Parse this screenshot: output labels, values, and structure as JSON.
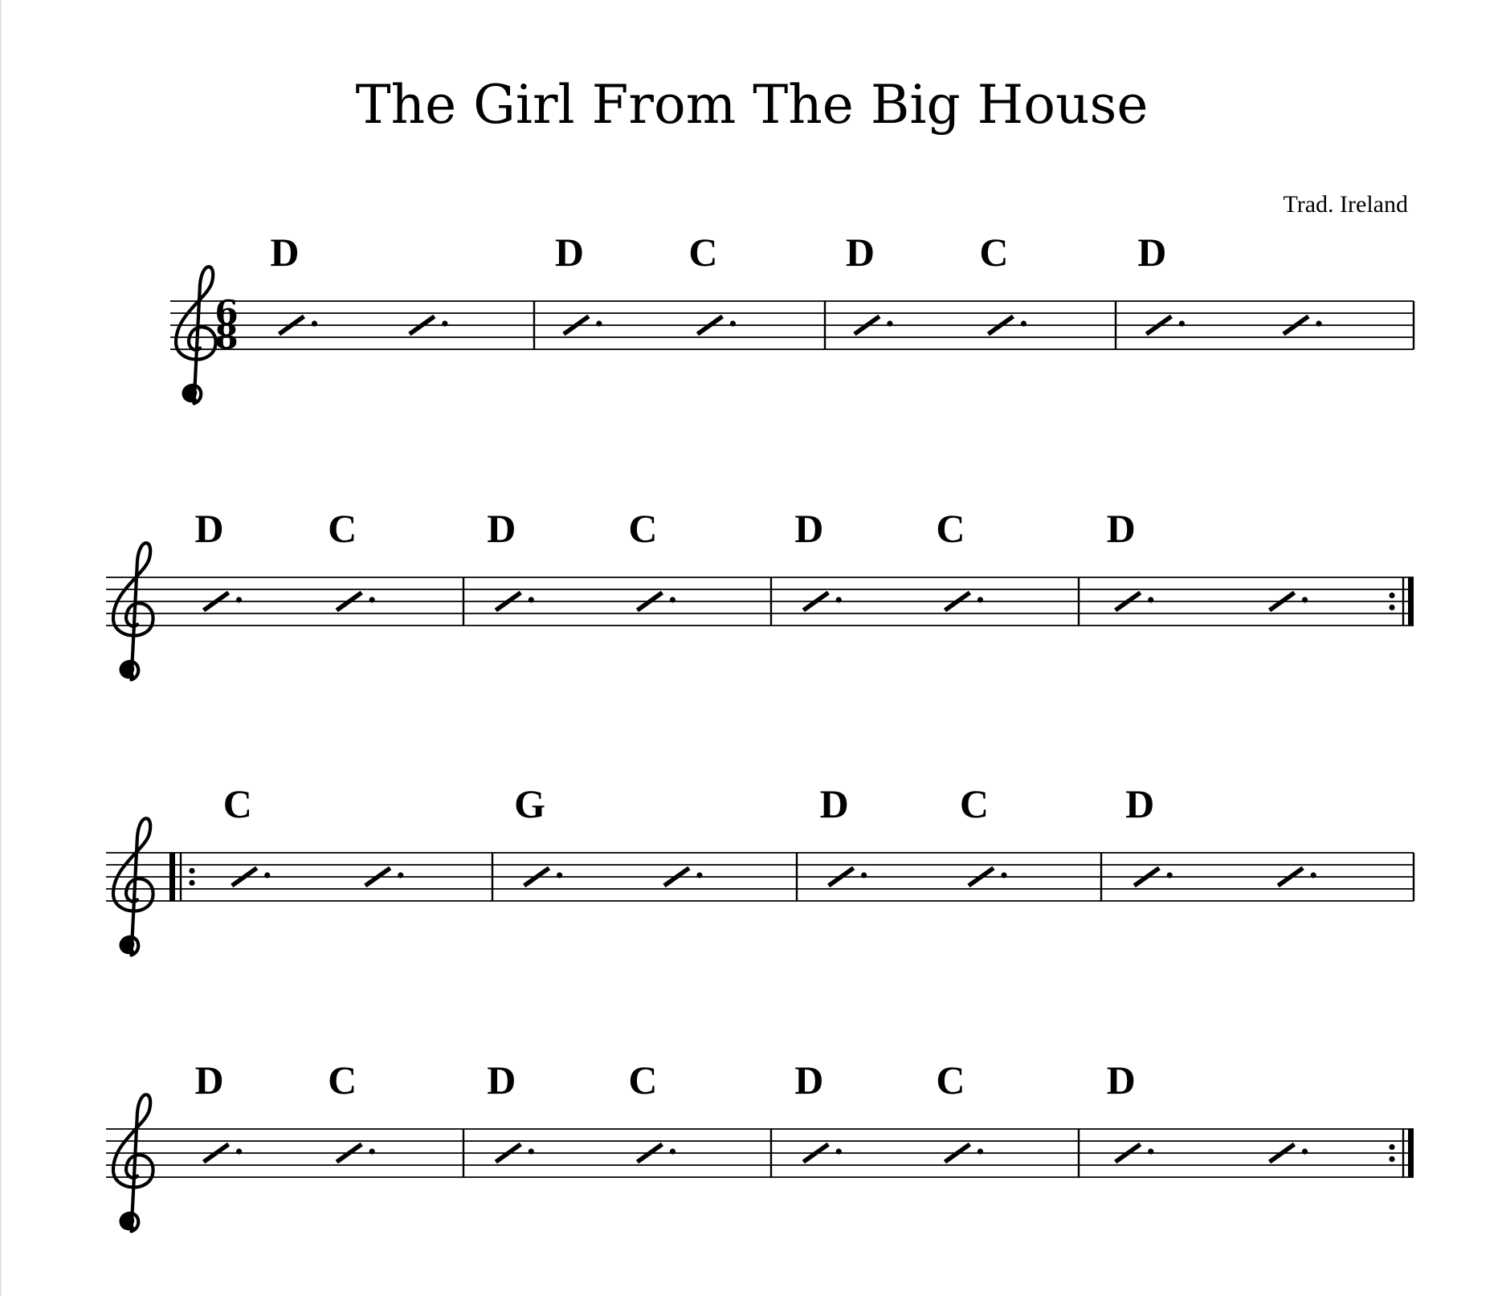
{
  "score": {
    "title": "The Girl From The Big House",
    "composer": "Trad. Ireland",
    "clef": "treble",
    "time_signature": {
      "numerator": "6",
      "denominator": "8"
    },
    "systems": [
      {
        "start_barline": "none",
        "end_barline": "single",
        "show_time_signature": true,
        "measures": [
          {
            "chords": [
              "D"
            ]
          },
          {
            "chords": [
              "D",
              "C"
            ]
          },
          {
            "chords": [
              "D",
              "C"
            ]
          },
          {
            "chords": [
              "D"
            ]
          }
        ]
      },
      {
        "start_barline": "none",
        "end_barline": "repeat-end",
        "show_time_signature": false,
        "measures": [
          {
            "chords": [
              "D",
              "C"
            ]
          },
          {
            "chords": [
              "D",
              "C"
            ]
          },
          {
            "chords": [
              "D",
              "C"
            ]
          },
          {
            "chords": [
              "D"
            ]
          }
        ]
      },
      {
        "start_barline": "repeat-start",
        "end_barline": "single",
        "show_time_signature": false,
        "measures": [
          {
            "chords": [
              "C"
            ]
          },
          {
            "chords": [
              "G"
            ]
          },
          {
            "chords": [
              "D",
              "C"
            ]
          },
          {
            "chords": [
              "D"
            ]
          }
        ]
      },
      {
        "start_barline": "none",
        "end_barline": "repeat-end",
        "show_time_signature": false,
        "measures": [
          {
            "chords": [
              "D",
              "C"
            ]
          },
          {
            "chords": [
              "D",
              "C"
            ]
          },
          {
            "chords": [
              "D",
              "C"
            ]
          },
          {
            "chords": [
              "D"
            ]
          }
        ]
      }
    ],
    "beat_notation": "dotted-slash",
    "beats_per_measure": 2
  }
}
